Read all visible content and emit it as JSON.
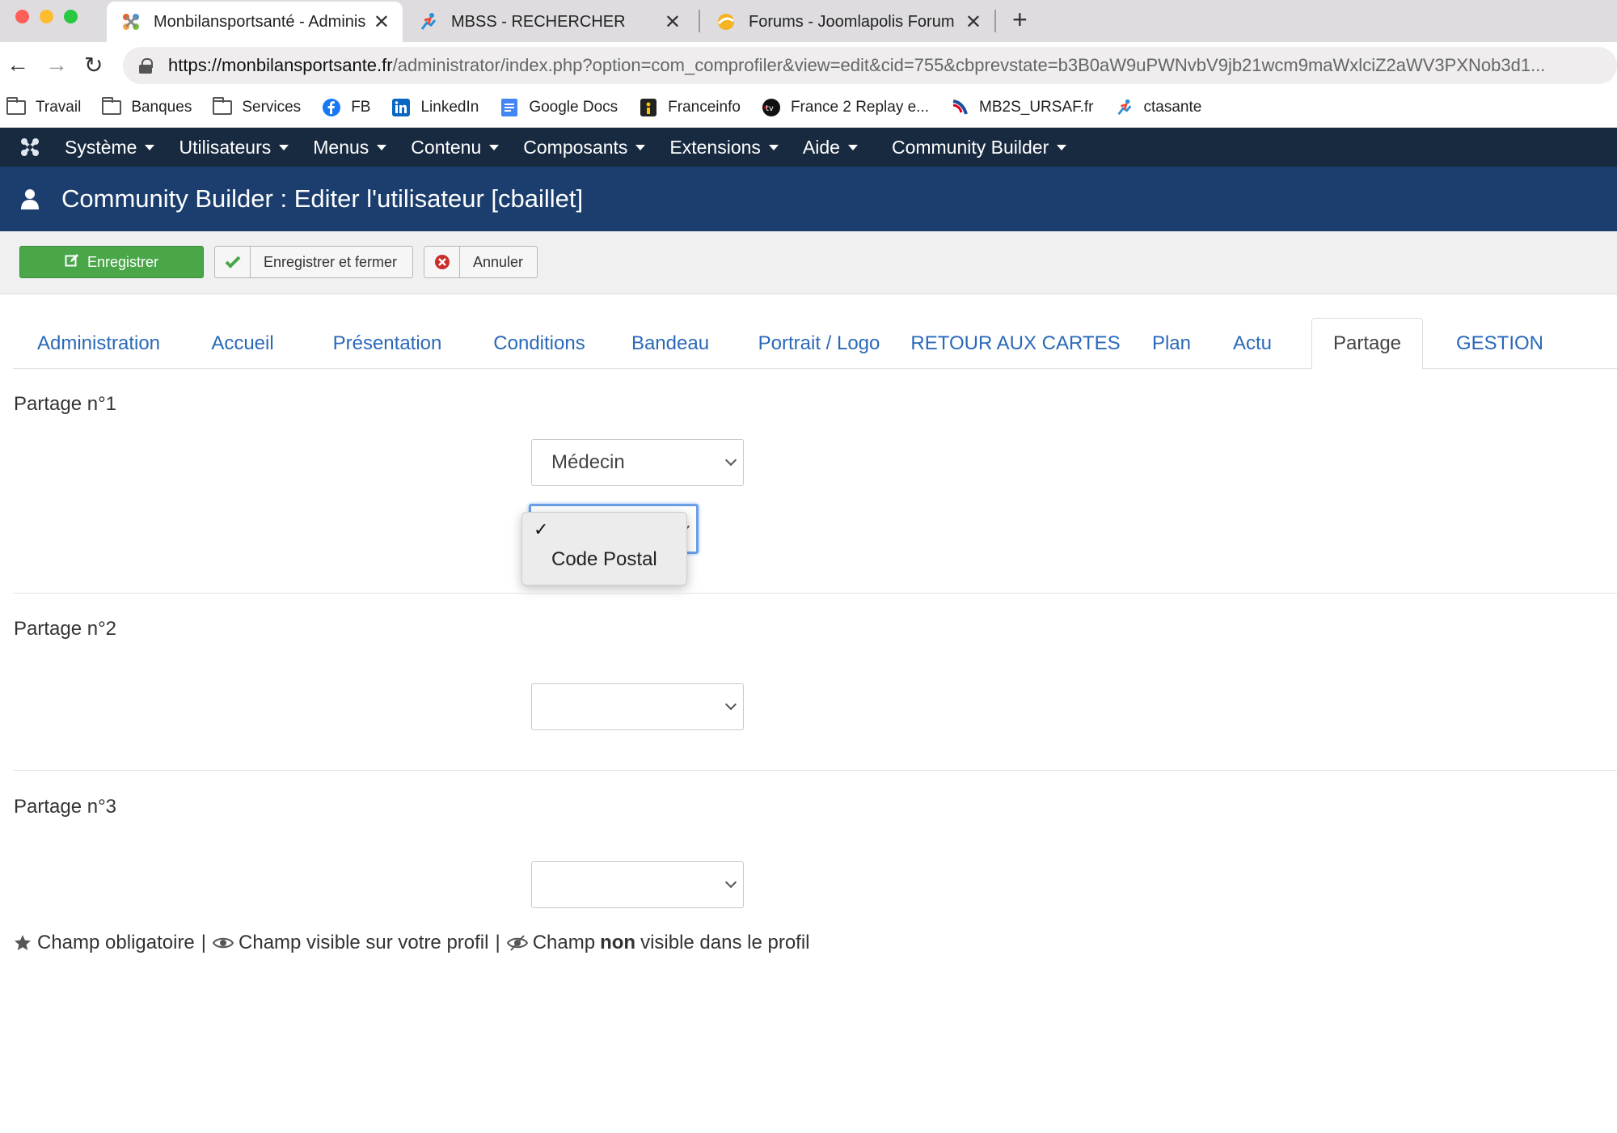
{
  "browser": {
    "tabs": [
      {
        "title": "Monbilansportsanté - Administ",
        "close": "✕"
      },
      {
        "title": "MBSS - RECHERCHER",
        "close": "✕"
      },
      {
        "title": "Forums - Joomlapolis Forum",
        "close": "✕"
      }
    ],
    "new_tab": "+",
    "url_host": "https://monbilansportsante.fr",
    "url_path": "/administrator/index.php?option=com_comprofiler&view=edit&cid=755&cbprevstate=b3B0aW9uPWNvbV9jb21wcm9maWxlciZ2aWV3PXNob3d1...",
    "bookmarks": [
      {
        "label": "Travail",
        "icon": "folder-icon"
      },
      {
        "label": "Banques",
        "icon": "folder-icon"
      },
      {
        "label": "Services",
        "icon": "folder-icon"
      },
      {
        "label": "FB",
        "icon": "facebook-icon"
      },
      {
        "label": "LinkedIn",
        "icon": "linkedin-icon"
      },
      {
        "label": "Google Docs",
        "icon": "google-docs-icon"
      },
      {
        "label": "Franceinfo",
        "icon": "franceinfo-icon"
      },
      {
        "label": "France 2 Replay e...",
        "icon": "france-tv-icon"
      },
      {
        "label": "MB2S_URSAF.fr",
        "icon": "ursaf-icon"
      },
      {
        "label": "ctasante",
        "icon": "runner-icon"
      }
    ]
  },
  "nav": {
    "items": [
      "Système",
      "Utilisateurs",
      "Menus",
      "Contenu",
      "Composants",
      "Extensions",
      "Aide"
    ],
    "community_builder": "Community Builder"
  },
  "page": {
    "title": "Community Builder : Editer l'utilisateur [cbaillet]"
  },
  "toolbar": {
    "save": "Enregistrer",
    "save_close": "Enregistrer et fermer",
    "cancel": "Annuler"
  },
  "tabs": [
    "Administration",
    "Accueil",
    "Présentation",
    "Conditions",
    "Bandeau",
    "Portrait / Logo",
    "RETOUR AUX CARTES",
    "Plan",
    "Actu",
    "Partage",
    "GESTION"
  ],
  "active_tab": "Partage",
  "sections": {
    "s1": {
      "label": "Partage n°1",
      "select1_value": "Médecin",
      "select2_value": ""
    },
    "s2": {
      "label": "Partage n°2",
      "select_value": ""
    },
    "s3": {
      "label": "Partage n°3",
      "select_value": ""
    }
  },
  "dropdown": {
    "options": [
      "",
      "Code Postal"
    ],
    "selected_mark": "✓"
  },
  "legend": {
    "required": "Champ obligatoire",
    "sep": "|",
    "visible": "Champ visible sur votre profil",
    "not_visible_pre": "Champ",
    "not_visible_bold": "non",
    "not_visible_post": "visible dans le profil"
  },
  "colors": {
    "nav_bg": "#182a40",
    "title_bg": "#1b3e6e",
    "save_green": "#4aa749",
    "link_blue": "#2a69b8"
  }
}
